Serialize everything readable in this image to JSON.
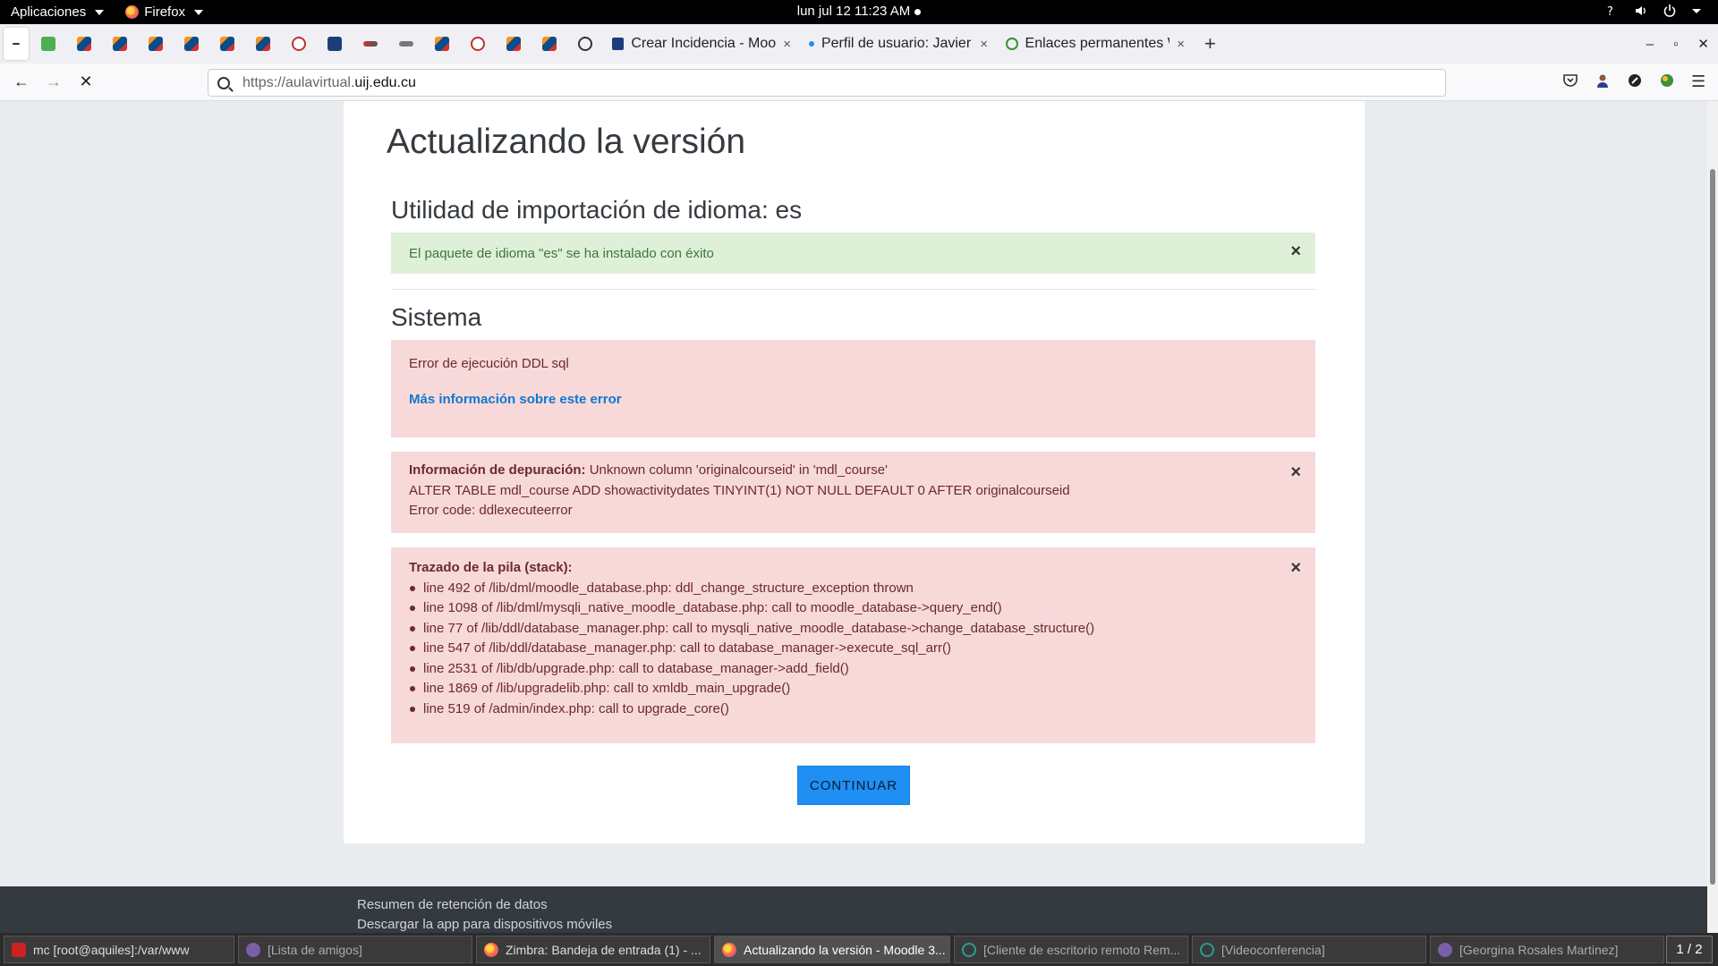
{
  "topbar": {
    "apps_menu": "Aplicaciones",
    "app_menu": "Firefox",
    "clock": "lun jul 12  11:23 AM"
  },
  "tabs": [
    {
      "title": "Crear Incidencia - Moodle",
      "close": "×"
    },
    {
      "title": "Perfil de usuario: Javier",
      "close": "×"
    },
    {
      "title": "Enlaces permanentes WordPress",
      "close": "×"
    }
  ],
  "newtab": "+",
  "window_controls": {
    "minimize": "–",
    "maximize": "▫",
    "close": "✕"
  },
  "navbar": {
    "back": "←",
    "forward": "→",
    "stop": "✕",
    "url_prefix": "https://aulavirtual.",
    "url_domain": "uij.edu.cu",
    "menu": "☰"
  },
  "page": {
    "title": "Actualizando la versión",
    "section1_heading": "Utilidad de importación de idioma: es",
    "success_message": "El paquete de idioma \"es\" se ha instalado con éxito",
    "section2_heading": "Sistema",
    "error_message": "Error de ejecución DDL sql",
    "more_info_link": "Más información sobre este error",
    "debug_label": "Información de depuración:",
    "debug_text": " Unknown column 'originalcourseid' in 'mdl_course'",
    "debug_sql": "ALTER TABLE mdl_course ADD showactivitydates TINYINT(1) NOT NULL DEFAULT 0 AFTER originalcourseid",
    "debug_code": "Error code: ddlexecuteerror",
    "stack_label": "Trazado de la pila (stack):",
    "stack": [
      "line 492 of /lib/dml/moodle_database.php: ddl_change_structure_exception thrown",
      "line 1098 of /lib/dml/mysqli_native_moodle_database.php: call to moodle_database->query_end()",
      "line 77 of /lib/ddl/database_manager.php: call to mysqli_native_moodle_database->change_database_structure()",
      "line 547 of /lib/ddl/database_manager.php: call to database_manager->execute_sql_arr()",
      "line 2531 of /lib/db/upgrade.php: call to database_manager->add_field()",
      "line 1869 of /lib/upgradelib.php: call to xmldb_main_upgrade()",
      "line 519 of /admin/index.php: call to upgrade_core()"
    ],
    "close_glyph": "×",
    "continue_button": "CONTINUAR"
  },
  "footer": {
    "link1": "Resumen de retención de datos",
    "link2": "Descargar la app para dispositivos móviles"
  },
  "taskbar": [
    {
      "label": "mc [root@aquiles]:/var/www",
      "icon": "terminal-icon"
    },
    {
      "label": "[Lista de amigos]",
      "icon": "pidgin-icon"
    },
    {
      "label": "Zimbra: Bandeja de entrada (1) - ...",
      "icon": "firefox-icon"
    },
    {
      "label": "Actualizando la versión - Moodle 3...",
      "icon": "firefox-icon"
    },
    {
      "label": "[Cliente de escritorio remoto Rem...",
      "icon": "remmina-icon"
    },
    {
      "label": "[Videoconferencia]",
      "icon": "remmina-icon"
    },
    {
      "label": "[Georgina Rosales Martinez]",
      "icon": "pidgin-icon"
    }
  ],
  "pager": "1 / 2",
  "colors": {
    "success_bg": "#dff0d8",
    "danger_bg": "#f7d9da",
    "button_blue": "#1f8ff3",
    "link_blue": "#1177d1"
  }
}
